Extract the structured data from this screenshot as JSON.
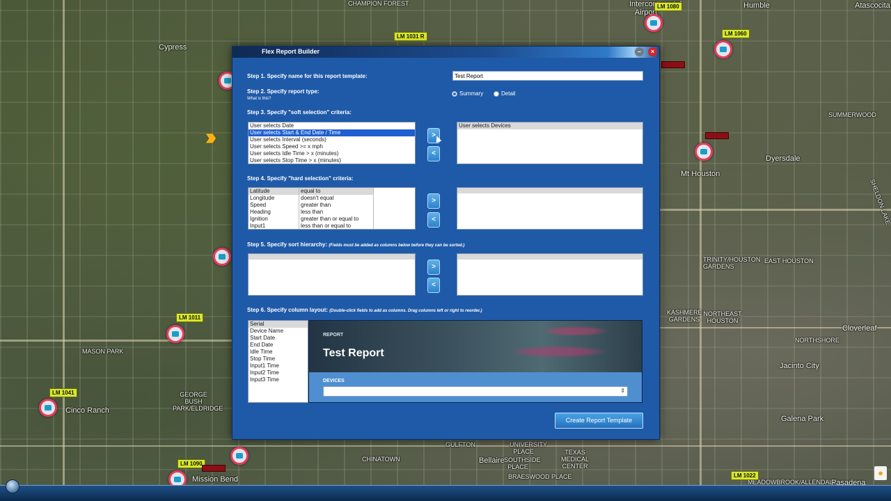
{
  "dialog": {
    "title": "Flex Report Builder",
    "min_label": "–",
    "close_label": "×"
  },
  "step1": {
    "label": "Step 1. Specify name for this report template:",
    "value": "Test Report"
  },
  "step2": {
    "label": "Step 2. Specify report type:",
    "hint": "What is this?",
    "options": [
      "Summary",
      "Detail"
    ],
    "selected": "Summary"
  },
  "step3": {
    "label": "Step 3. Specify \"soft selection\" criteria:",
    "available": [
      "User selects Date",
      "User selects Start & End Date / Time",
      "User selects Interval (seconds)",
      "User selects Speed >= x mph",
      "User selects Idle Time > x (minutes)",
      "User selects Stop Time > x (minutes)"
    ],
    "selected": [
      "User selects Devices"
    ]
  },
  "step4": {
    "label": "Step 4. Specify \"hard selection\" criteria:",
    "fields": [
      "Latitude",
      "Longitude",
      "Speed",
      "Heading",
      "Ignition",
      "Input1"
    ],
    "operators": [
      "equal to",
      "doesn't equal",
      "greater than",
      "less than",
      "greater than or equal to",
      "less than or equal to"
    ]
  },
  "step5": {
    "label": "Step 5. Specify sort hierarchy:",
    "hint": "(Fields must be added as columns below before they can be sorted.)"
  },
  "step6": {
    "label": "Step 6. Specify column layout:",
    "hint": "(Double-click fields to add as columns. Drag columns left or right to reorder.)",
    "fields": [
      "Serial",
      "Device Name",
      "Start Date",
      "End Date",
      "Idle Time",
      "Stop Time",
      "Input1 Time",
      "Input2 Time",
      "Input3 Time"
    ]
  },
  "buttons": {
    "add": ">",
    "remove": "<",
    "create": "Create Report Template"
  },
  "preview": {
    "section_label": "REPORT",
    "title": "Test Report",
    "devices_label": "DEVICES",
    "caret": "⇕"
  },
  "map": {
    "labels": [
      "Cypress",
      "MASON PARK",
      "GEORGE BUSH PARK/ELDRIDGE",
      "Cinco Ranch",
      "Mt Houston",
      "Dyersdale",
      "SUMMERWOOD",
      "TRINITY/HOUSTON GARDENS",
      "EAST HOUSTON",
      "KASHMERE GARDENS",
      "NORTHEAST HOUSTON",
      "NORTHSHORE",
      "Cloverleaf",
      "Jacinto City",
      "Galena Park",
      "Bellaire",
      "University Place",
      "TEXAS MEDICAL CENTER",
      "Southside Place",
      "CHINATOWN",
      "Intercontinental Airport",
      "Humble",
      "Atascocita",
      "Mission Bend",
      "CHAMPION FOREST",
      "BRAESWOOD PLACE",
      "MEADOWBROOK/ALLENDALE",
      "Pasadena",
      "GULFTON",
      "Sheldon Lake"
    ],
    "landmarks": [
      "LM 1080",
      "LM 1060",
      "LM 1031 R",
      "LM 1011",
      "LM 1041",
      "LM 1090",
      "LM 1022"
    ]
  },
  "colors": {
    "dialog_bg": "#1f5aa8",
    "accent": "#1e5fd1",
    "button": "#2c82cc",
    "close": "#d0262d",
    "landmark_tag": "#d8e82a",
    "pin_ring": "#e63a66"
  }
}
